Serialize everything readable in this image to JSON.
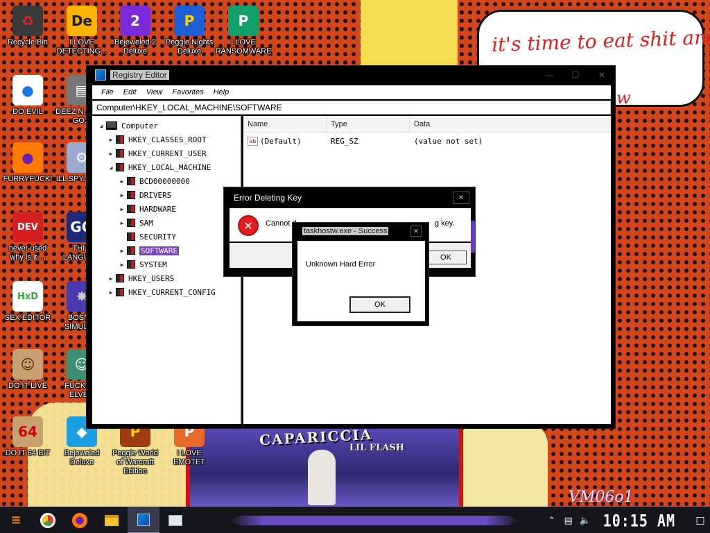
{
  "desktop": {
    "bubble_text": "it's time to eat shit and die and chew",
    "bubble_text_extra": "w",
    "album_title": "CAPARICCIA",
    "album_subtitle": "LIL FLASH",
    "watermark": "VM06o1",
    "icons": [
      {
        "label": "Recycle Bin",
        "glyph": "♻",
        "bg": "#3a3a3a",
        "fg": "#e22"
      },
      {
        "label": "I LOVE DETECTING...",
        "glyph": "De",
        "bg": "#ffb400",
        "fg": "#1a1a1a"
      },
      {
        "label": "Bejeweled 2 Deluxe",
        "glyph": "2",
        "bg": "#7a2ad8",
        "fg": "#fff"
      },
      {
        "label": "Peggle Nights Deluxe",
        "glyph": "P",
        "bg": "#1e5fd8",
        "fg": "#ffd200"
      },
      {
        "label": "I LOVE RANSOMWARE",
        "glyph": "P",
        "bg": "#12a06a",
        "fg": "#fff"
      },
      {
        "label": "DO EVIL",
        "glyph": "●",
        "bg": "#ffffff",
        "fg": "#1a73e8"
      },
      {
        "label": "DEEZ N... HAH GO...",
        "glyph": "▤",
        "bg": "#777",
        "fg": "#fff"
      },
      {
        "label": "FURRYFUCK!",
        "glyph": "●",
        "bg": "#ff7a00",
        "fg": "#6a1fb0"
      },
      {
        "label": "ILL SPY... YOU",
        "glyph": "⚙",
        "bg": "#9ac",
        "fg": "#fff"
      },
      {
        "label": "never used why is it ...",
        "glyph": "DEV",
        "bg": "#d62020",
        "fg": "#fff"
      },
      {
        "label": "THI... LANGUA...",
        "glyph": "GO",
        "bg": "#1d2a7a",
        "fg": "#fff"
      },
      {
        "label": "SEX EDITOR",
        "glyph": "HxD",
        "bg": "#fff",
        "fg": "#3a3"
      },
      {
        "label": "BOSN... SIMULA...",
        "glyph": "✸",
        "bg": "#4a3ab0",
        "fg": "#ccc"
      },
      {
        "label": "DO IT LIVE",
        "glyph": "☺",
        "bg": "#c9a070",
        "fg": "#4a2a10"
      },
      {
        "label": "FUCK S... ELVE...",
        "glyph": "☺",
        "bg": "#3a9070",
        "fg": "#fff"
      },
      {
        "label": "DO IT 64 BIT",
        "glyph": "64",
        "bg": "#c9a070",
        "fg": "#c01"
      },
      {
        "label": "Bejeweled Deluxe",
        "glyph": "◆",
        "bg": "#1aa0e0",
        "fg": "#fff"
      },
      {
        "label": "Peggle World of Warcraft Edition",
        "glyph": "P",
        "bg": "#a03a10",
        "fg": "#ffd200"
      },
      {
        "label": "I LOVE EMOTET",
        "glyph": "P",
        "bg": "#e86a2a",
        "fg": "#fff"
      }
    ]
  },
  "regedit": {
    "title": "Registry Editor",
    "menu": [
      "File",
      "Edit",
      "View",
      "Favorites",
      "Help"
    ],
    "address": "Computer\\HKEY_LOCAL_MACHINE\\SOFTWARE",
    "tree": {
      "root": "Computer",
      "hives": [
        "HKEY_CLASSES_ROOT",
        "HKEY_CURRENT_USER",
        "HKEY_LOCAL_MACHINE"
      ],
      "hklm_children": [
        "BCD00000000",
        "DRIVERS",
        "HARDWARE",
        "SAM",
        "SECURITY",
        "SOFTWARE",
        "SYSTEM"
      ],
      "hives_after": [
        "HKEY_USERS",
        "HKEY_CURRENT_CONFIG"
      ],
      "selected": "SOFTWARE"
    },
    "columns": [
      "Name",
      "Type",
      "Data"
    ],
    "rows": [
      {
        "name": "(Default)",
        "type": "REG_SZ",
        "data": "(value not set)"
      }
    ]
  },
  "error_dialog": {
    "title": "Error Deleting Key",
    "message_left": "Cannot d",
    "message_right": "g key.",
    "ok_label": "OK"
  },
  "success_dialog": {
    "title": "taskhostw.exe - Success",
    "message": "Unknown Hard Error",
    "ok_label": "OK"
  },
  "taskbar": {
    "clock": "10:15 AM"
  }
}
